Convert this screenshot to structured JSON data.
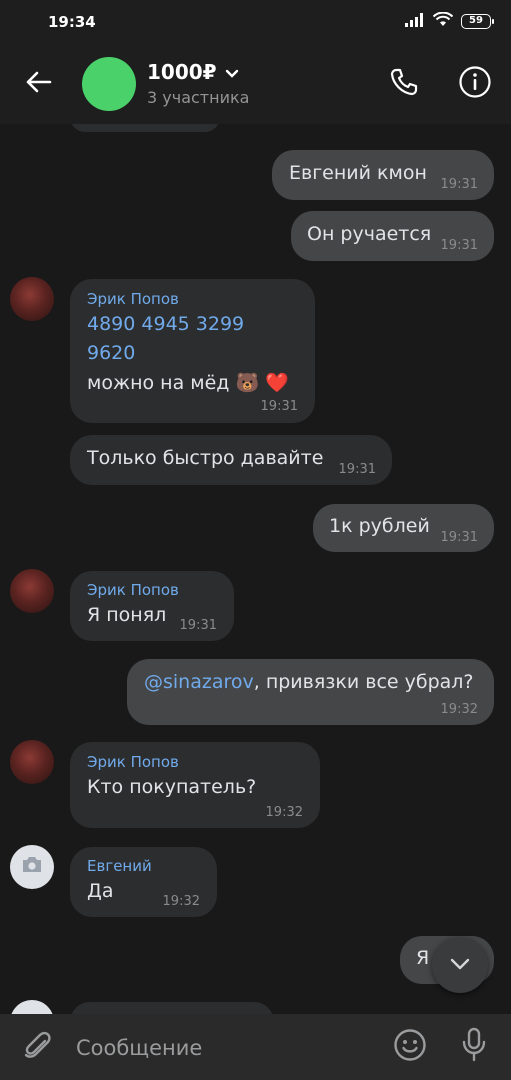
{
  "status_bar": {
    "time": "19:34",
    "battery": "59",
    "icons": [
      "signal-icon",
      "wifi-icon",
      "battery-icon"
    ]
  },
  "header": {
    "title": "1000₽",
    "subtitle": "3 участника",
    "icons": [
      "back-arrow-icon",
      "chevron-down-icon",
      "phone-icon",
      "info-icon"
    ]
  },
  "colors": {
    "background": "#19191a",
    "incoming_bubble": "#2c2d2e",
    "outgoing_bubble": "#454647",
    "link": "#71aaeb",
    "chat_avatar": "#4bd16a"
  },
  "messages": [
    {
      "text": "Евгений кмон",
      "time": "19:31",
      "outgoing": true
    },
    {
      "text": "Он ручается",
      "time": "19:31",
      "outgoing": true
    },
    {
      "sender": "Эрик Попов",
      "card_line1": "4890 4945 3299",
      "card_line2": "9620",
      "text": "можно на мёд 🐻 ❤️",
      "time": "19:31",
      "outgoing": false
    },
    {
      "text": "Только быстро давайте",
      "time": "19:31",
      "outgoing": false
    },
    {
      "text": "1к рублей",
      "time": "19:31",
      "outgoing": true
    },
    {
      "sender": "Эрик Попов",
      "text": "Я понял",
      "time": "19:31",
      "outgoing": false
    },
    {
      "mention": "@sinazarov",
      "text": ", привязки все убрал?",
      "time": "19:32",
      "outgoing": true
    },
    {
      "sender": "Эрик Попов",
      "text": "Кто покупатель?",
      "time": "19:32",
      "outgoing": false
    },
    {
      "sender": "Евгений",
      "text": "Да",
      "time": "19:32",
      "outgoing": false
    },
    {
      "text": "Я",
      "outgoing": true
    }
  ],
  "composer": {
    "placeholder": "Сообщение",
    "icons": [
      "paperclip-icon",
      "emoji-icon",
      "microphone-icon"
    ]
  }
}
